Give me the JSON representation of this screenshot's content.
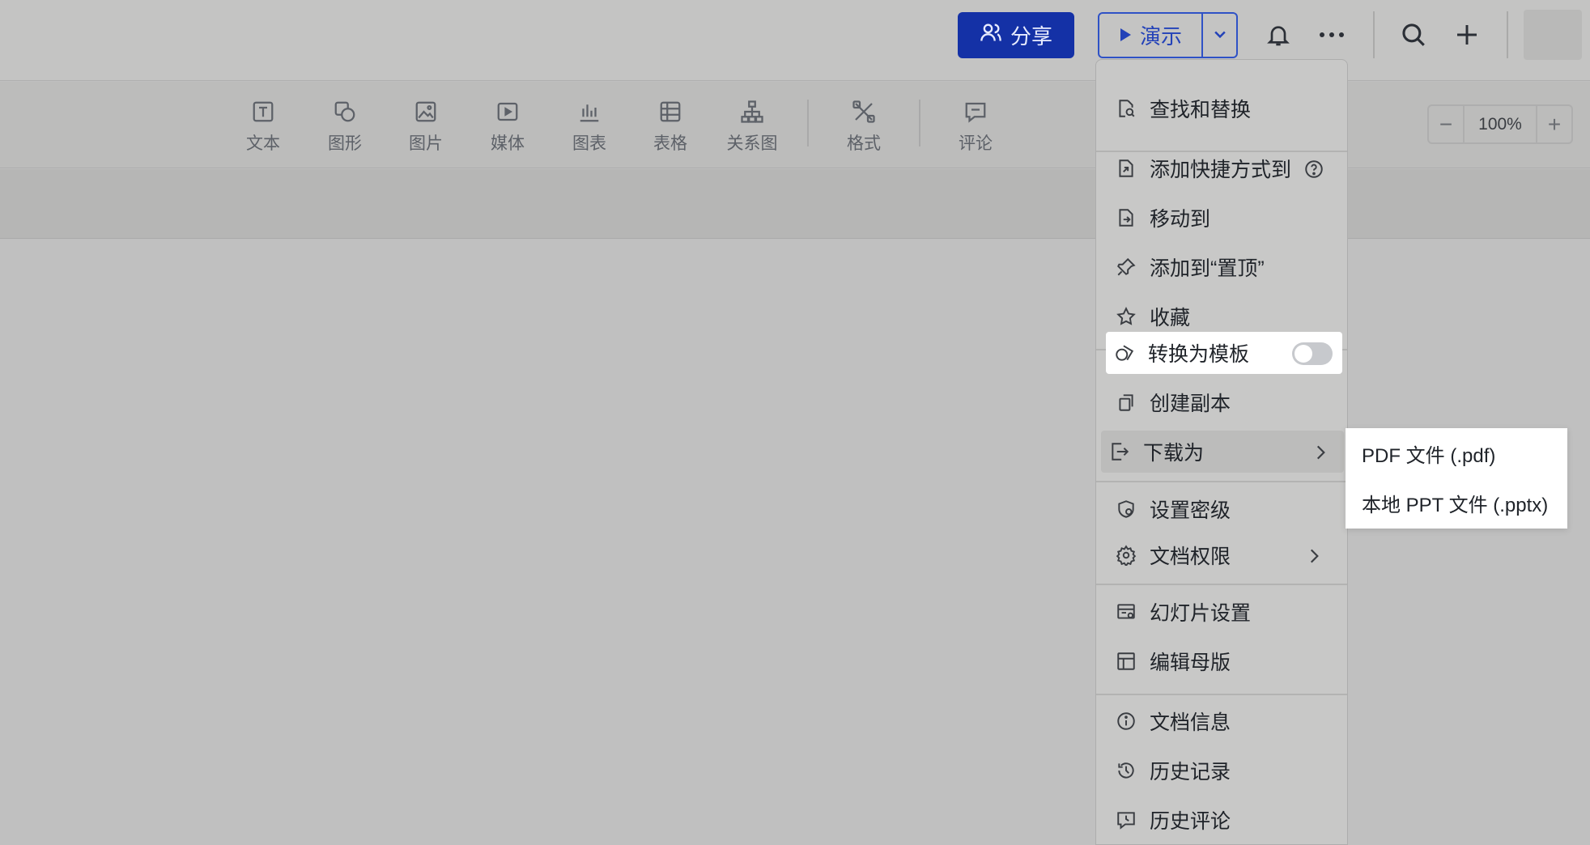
{
  "header": {
    "share_label": "分享",
    "present_label": "演示"
  },
  "toolbar": {
    "items": [
      {
        "label": "文本",
        "icon": "text-icon"
      },
      {
        "label": "图形",
        "icon": "shape-icon"
      },
      {
        "label": "图片",
        "icon": "image-icon"
      },
      {
        "label": "媒体",
        "icon": "media-icon"
      },
      {
        "label": "图表",
        "icon": "chart-icon"
      },
      {
        "label": "表格",
        "icon": "table-icon"
      },
      {
        "label": "关系图",
        "icon": "diagram-icon"
      },
      {
        "label": "格式",
        "icon": "format-icon"
      },
      {
        "label": "评论",
        "icon": "comment-icon"
      }
    ],
    "zoom": {
      "minus": "−",
      "value": "100%",
      "plus": "+"
    }
  },
  "menu": {
    "items": [
      {
        "label": "查找和替换",
        "icon": "find-replace-icon"
      },
      {
        "label": "添加快捷方式到",
        "icon": "shortcut-icon"
      },
      {
        "label": "移动到",
        "icon": "move-icon"
      },
      {
        "label": "添加到“置顶”",
        "icon": "pin-icon"
      },
      {
        "label": "收藏",
        "icon": "star-icon"
      },
      {
        "label": "转换为模板",
        "icon": "template-icon",
        "toggle": false
      },
      {
        "label": "创建副本",
        "icon": "copy-icon"
      },
      {
        "label": "下载为",
        "icon": "download-icon",
        "submenu": true
      },
      {
        "label": "设置密级",
        "icon": "security-level-icon"
      },
      {
        "label": "文档权限",
        "icon": "permission-icon",
        "submenu": true
      },
      {
        "label": "幻灯片设置",
        "icon": "slide-settings-icon"
      },
      {
        "label": "编辑母版",
        "icon": "master-icon"
      },
      {
        "label": "文档信息",
        "icon": "info-icon"
      },
      {
        "label": "历史记录",
        "icon": "history-icon"
      },
      {
        "label": "历史评论",
        "icon": "history-comment-icon"
      }
    ]
  },
  "submenu": {
    "items": [
      {
        "label": "PDF 文件 (.pdf)"
      },
      {
        "label": "本地 PPT 文件 (.pptx)"
      }
    ]
  },
  "colors": {
    "share_bg": "#1431a6",
    "present_border": "#2f52c6",
    "menu_bg": "#c8c8c7",
    "highlight_bg": "#ffffff"
  }
}
